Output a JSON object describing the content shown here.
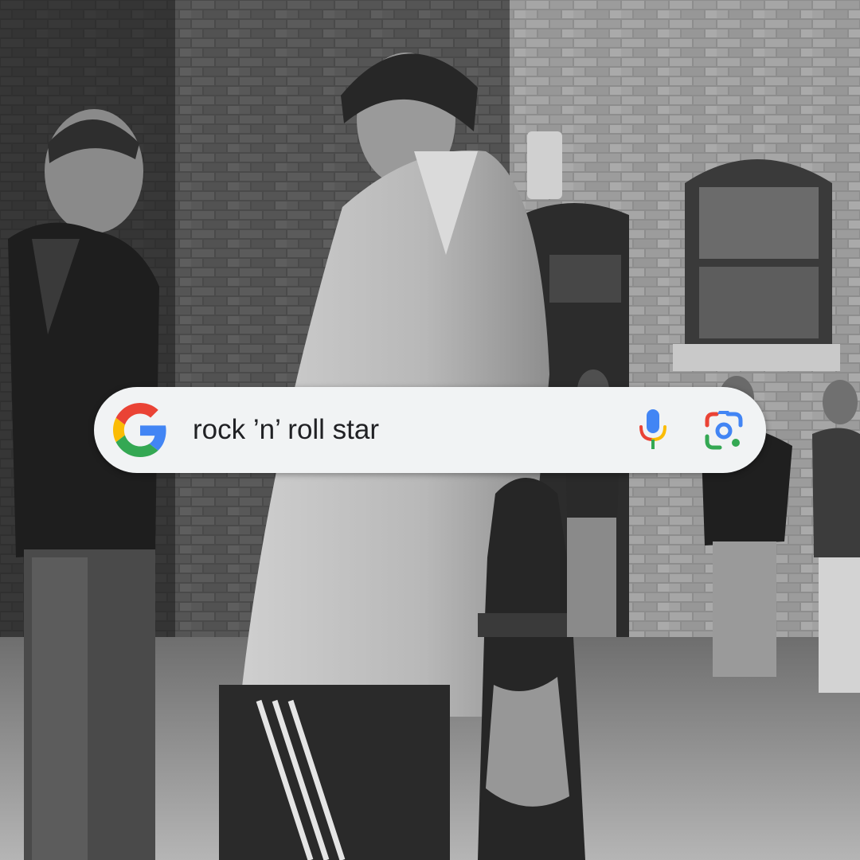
{
  "search": {
    "query": "rock ’n’ roll star"
  },
  "icons": {
    "logo": "google-g-logo",
    "voice": "microphone-icon",
    "camera": "google-lens-icon"
  },
  "colors": {
    "searchbar_bg": "#f1f3f4",
    "text": "#202124",
    "google_blue": "#4285F4",
    "google_red": "#EA4335",
    "google_yellow": "#FBBC05",
    "google_green": "#34A853"
  }
}
